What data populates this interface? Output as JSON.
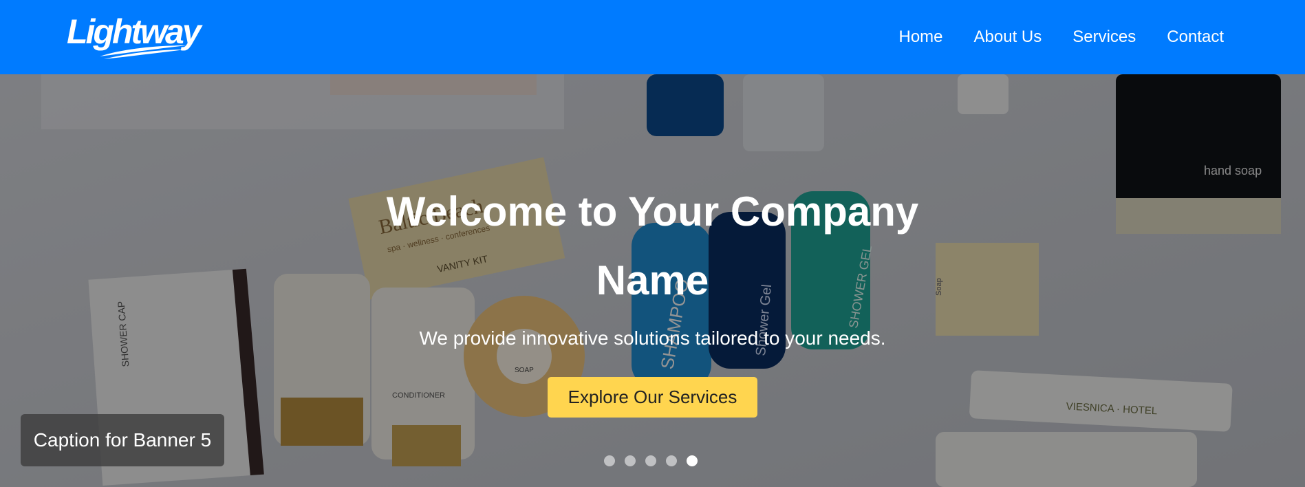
{
  "brand": {
    "logo_text": "Lightway"
  },
  "nav": {
    "items": [
      {
        "label": "Home"
      },
      {
        "label": "About Us"
      },
      {
        "label": "Services"
      },
      {
        "label": "Contact"
      }
    ]
  },
  "hero": {
    "title": "Welcome to Your Company Name",
    "subtitle": "We provide innovative solutions tailored to your needs.",
    "cta_label": "Explore Our Services",
    "caption": "Caption for Banner 5",
    "slide_count": 5,
    "active_slide": 5,
    "image_labels": {
      "shower_cap": "SHOWER CAP",
      "vanity_brand": "Baltic Beach",
      "vanity_line": "spa · wellness · conferences",
      "vanity_kit": "VANITY KIT",
      "soap": "SOAP",
      "conditioner": "CONDITIONER",
      "shampoo": "SHAMPOO",
      "shower_gel": "Shower Gel",
      "shower_gel_2": "SHOWER GEL",
      "hand_soap": "hand soap",
      "soap_bar": "Soap",
      "viesnica": "VIESNICA · HOTEL"
    }
  },
  "colors": {
    "header_bg": "#007bff",
    "cta_bg": "#ffd54f",
    "caption_bg": "#3c3c3c"
  }
}
